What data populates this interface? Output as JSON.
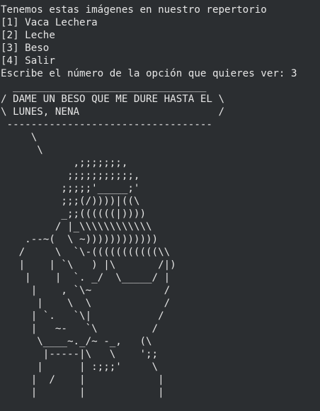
{
  "terminal": {
    "header": "Tenemos estas imágenes en nuestro repertorio",
    "menu": [
      "[1] Vaca Lechera",
      "[2] Leche",
      "[3] Beso",
      "[4] Salir"
    ],
    "prompt": "Escribe el número de la opción que quieres ver: 3",
    "art": [
      "  ________________________________",
      "/ DAME UN BESO QUE ME DURE HASTA EL \\",
      "\\ LUNES, NENA                       /",
      " ----------------------------------",
      "     \\",
      "      \\",
      "            ,;;;;;;;,",
      "           ;;;;;;;;;;;,",
      "          ;;;;;'_____;'",
      "          ;;;(/))))|((\\",
      "          _;;((((((|))))",
      "         / |_\\\\\\\\\\\\\\\\\\\\\\\\",
      "    .--~(  \\ ~))))))))))))",
      "   /     \\  `\\-(((((((((((\\\\",
      "   |    | `\\   ) |\\       /|)",
      "    |    |  `. _/  \\_____/ |",
      "     |    , `\\~            /",
      "      |    \\  \\            /",
      "     | `.   `\\|           /",
      "     |   ~-   `\\         /",
      "      \\____~._/~ -_,   (\\",
      "       |-----|\\   \\    ';;",
      "      |      | :;;;'     \\",
      "     |  /    |            |",
      "     |       |            |"
    ]
  }
}
